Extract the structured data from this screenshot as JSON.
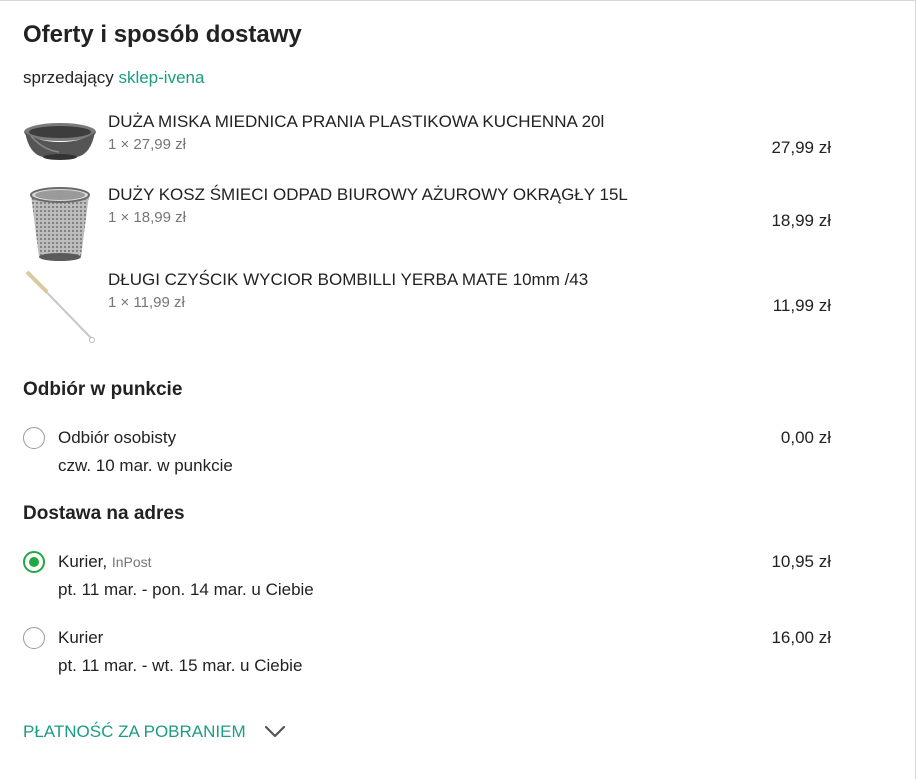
{
  "header": {
    "title": "Oferty i sposób dostawy",
    "seller_prefix": "sprzedający",
    "seller_name": "sklep-ivena"
  },
  "products": [
    {
      "name": "DUŻA MISKA MIEDNICA PRANIA PLASTIKOWA KUCHENNA 20l",
      "quantity": "1 × 27,99 zł",
      "price": "27,99 zł",
      "icon": "basin-image"
    },
    {
      "name": "DUŻY KOSZ ŚMIECI ODPAD BIUROWY AŻUROWY OKRĄGŁY 15L",
      "quantity": "1 × 18,99 zł",
      "price": "18,99 zł",
      "icon": "wastebasket-image"
    },
    {
      "name": "DŁUGI CZYŚCIK WYCIOR BOMBILLI YERBA MATE 10mm /43",
      "quantity": "1 × 11,99 zł",
      "price": "11,99 zł",
      "icon": "brush-image"
    }
  ],
  "pickup": {
    "heading": "Odbiór w punkcie",
    "options": [
      {
        "label": "Odbiór osobisty",
        "carrier": "",
        "date": "czw. 10 mar. w punkcie",
        "price": "0,00 zł",
        "selected": false
      }
    ]
  },
  "delivery": {
    "heading": "Dostawa na adres",
    "options": [
      {
        "label": "Kurier,",
        "carrier": "InPost",
        "date": "pt. 11 mar. - pon. 14 mar. u Ciebie",
        "price": "10,95 zł",
        "selected": true
      },
      {
        "label": "Kurier",
        "carrier": "",
        "date": "pt. 11 mar. - wt. 15 mar. u Ciebie",
        "price": "16,00 zł",
        "selected": false
      }
    ]
  },
  "payment": {
    "label": "PŁATNOŚĆ ZA POBRANIEM",
    "icon": "chevron-down-icon"
  },
  "colors": {
    "accent": "#1b9c85",
    "radio_selected": "#20a940",
    "text": "#222222",
    "muted": "#767676",
    "border": "#d6d6d6"
  }
}
